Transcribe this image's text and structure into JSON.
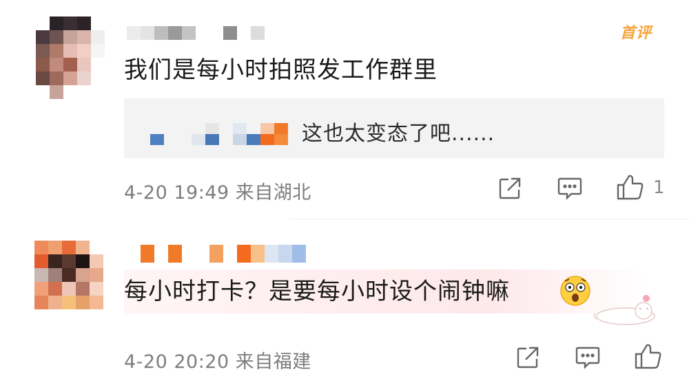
{
  "comments": [
    {
      "badge": "首评",
      "text": "我们是每小时拍照发工作群里",
      "reply": {
        "text": "这也太变态了吧......"
      },
      "meta": "4-20 19:49 来自湖北",
      "like_count": "1",
      "icons": [
        "share-icon",
        "comment-icon",
        "like-icon"
      ]
    },
    {
      "text": "每小时打卡？是要每小时设个闹钟嘛",
      "emoji": "shocked-emoji-icon",
      "meta": "4-20 20:20 来自福建",
      "icons": [
        "share-icon",
        "comment-icon",
        "like-icon"
      ]
    }
  ],
  "colors": {
    "text": "#1a1a1a",
    "meta": "#7d7d7d",
    "reply_bg": "#f3f3f3",
    "badge": "#f6a33c",
    "icon": "#666666"
  }
}
